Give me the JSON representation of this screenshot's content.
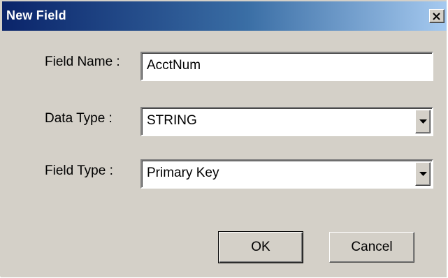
{
  "window": {
    "title": "New Field",
    "close_icon": "close-icon"
  },
  "form": {
    "field_name": {
      "label": "Field Name :",
      "value": "AcctNum"
    },
    "data_type": {
      "label": "Data Type  :",
      "value": "STRING",
      "arrow_icon": "chevron-down-icon"
    },
    "field_type": {
      "label": "Field Type  :",
      "value": "Primary Key",
      "arrow_icon": "chevron-down-icon"
    }
  },
  "buttons": {
    "ok_label": "OK",
    "cancel_label": "Cancel"
  },
  "colors": {
    "title_start": "#0a246a",
    "title_end": "#a6caf0",
    "face": "#d4d0c8"
  }
}
